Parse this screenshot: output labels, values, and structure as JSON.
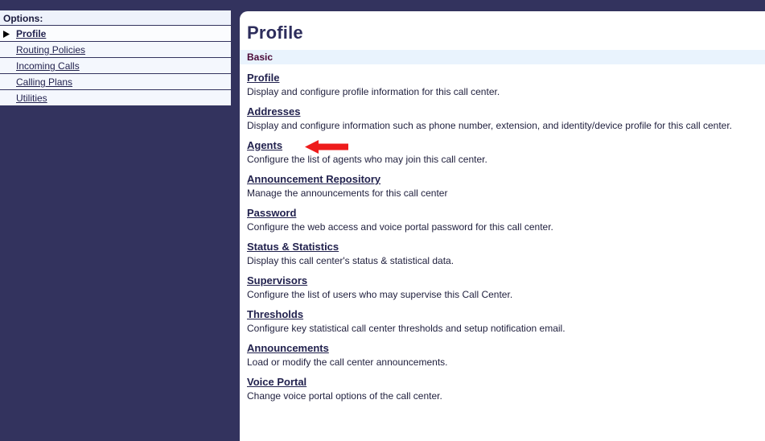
{
  "sidebar": {
    "header": "Options:",
    "items": [
      {
        "label": "Profile",
        "marker": "triangle-right-icon",
        "selected": true
      },
      {
        "label": "Routing Policies",
        "selected": false
      },
      {
        "label": "Incoming Calls",
        "selected": false
      },
      {
        "label": "Calling Plans",
        "selected": false
      },
      {
        "label": "Utilities",
        "selected": false
      }
    ]
  },
  "content": {
    "title": "Profile",
    "section": "Basic",
    "items": [
      {
        "link": "Profile",
        "desc": "Display and configure profile information for this call center."
      },
      {
        "link": "Addresses",
        "desc": "Display and configure information such as phone number, extension, and identity/device profile for this call center."
      },
      {
        "link": "Agents",
        "desc": "Configure the list of agents who may join this call center.",
        "annotation": "red-left-arrow"
      },
      {
        "link": "Announcement Repository",
        "desc": "Manage the announcements for this call center"
      },
      {
        "link": "Password",
        "desc": "Configure the web access and voice portal password for this call center."
      },
      {
        "link": "Status & Statistics",
        "desc": "Display this call center's status & statistical data."
      },
      {
        "link": "Supervisors",
        "desc": "Configure the list of users who may supervise this Call Center."
      },
      {
        "link": "Thresholds",
        "desc": "Configure key statistical call center thresholds and setup notification email."
      },
      {
        "link": "Announcements",
        "desc": "Load or modify the call center announcements."
      },
      {
        "link": "Voice Portal",
        "desc": "Change voice portal options of the call center."
      }
    ]
  },
  "colors": {
    "background": "#33335e",
    "panel": "#ffffff",
    "link": "#22224e",
    "section_header_text": "#4b0a38",
    "section_header_bg": "#e9f3fd",
    "arrow": "#ee1c1c"
  }
}
